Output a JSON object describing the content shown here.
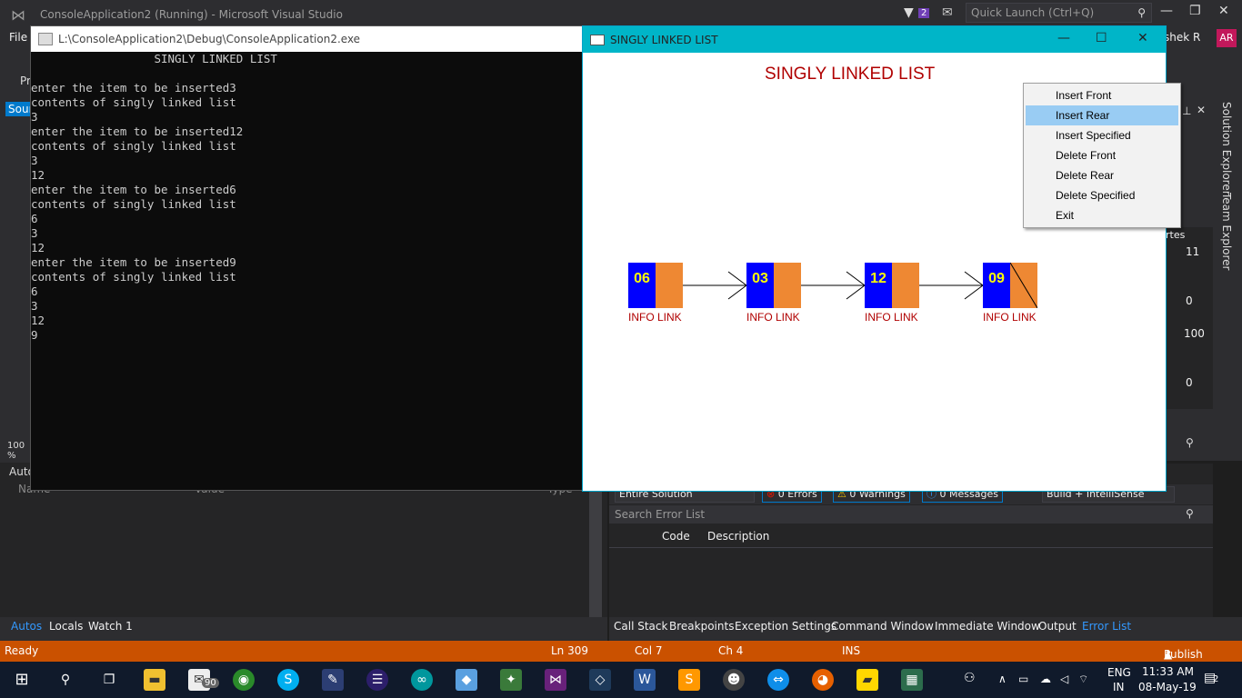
{
  "vs": {
    "title": "ConsoleApplication2 (Running) - Microsoft Visual Studio",
    "notifications": "2",
    "quick_launch": "Quick Launch (Ctrl+Q)",
    "menu_file": "File",
    "user": "shek R",
    "avatar": "AR",
    "left_tab": "Sour",
    "left_pr": "Pr",
    "zoom": "100 %"
  },
  "console": {
    "title": "L:\\ConsoleApplication2\\Debug\\ConsoleApplication2.exe",
    "lines": "                  SINGLY LINKED LIST\n\nenter the item to be inserted3\ncontents of singly linked list\n3\nenter the item to be inserted12\ncontents of singly linked list\n3\n12\nenter the item to be inserted6\ncontents of singly linked list\n6\n3\n12\nenter the item to be inserted9\ncontents of singly linked list\n6\n3\n12\n9"
  },
  "graphics": {
    "title": "SINGLY LINKED LIST",
    "heading": "SINGLY LINKED LIST",
    "nodes": [
      {
        "value": "06",
        "label": "INFO LINK"
      },
      {
        "value": "03",
        "label": "INFO LINK"
      },
      {
        "value": "12",
        "label": "INFO LINK"
      },
      {
        "value": "09",
        "label": "INFO LINK"
      }
    ],
    "colors": {
      "info": "#0000ff",
      "link": "#ee8833",
      "text": "#ffff00",
      "label": "#b00000"
    }
  },
  "context_menu": {
    "items": [
      "Insert Front",
      "Insert Rear",
      "Insert Specified",
      "Delete Front",
      "Delete Rear",
      "Delete Specified",
      "Exit"
    ],
    "selected": "Insert Rear"
  },
  "autos": {
    "header": "Autos",
    "col_name": "Name",
    "col_value": "Value",
    "col_type": "Type",
    "tabs": [
      "Autos",
      "Locals",
      "Watch 1"
    ]
  },
  "right_panel": {
    "solution_explorer": "Solution Explorer",
    "team_explorer": "Team Explorer",
    "props_label": "rtes",
    "v1": "11",
    "v2": "0",
    "v3": "100",
    "v4": "0"
  },
  "error_list": {
    "scope": "Entire Solution",
    "errors": "0 Errors",
    "warnings": "0 Warnings",
    "messages": "0 Messages",
    "filter": "Build + IntelliSense",
    "search": "Search Error List",
    "col_code": "Code",
    "col_desc": "Description",
    "tabs": [
      "Call Stack",
      "Breakpoints",
      "Exception Settings",
      "Command Window",
      "Immediate Window",
      "Output",
      "Error List"
    ]
  },
  "status": {
    "ready": "Ready",
    "ln": "Ln 309",
    "col": "Col 7",
    "ch": "Ch 4",
    "ins": "INS",
    "publish": "Publish"
  },
  "taskbar": {
    "lang1": "ENG",
    "lang2": "IN",
    "time": "11:33 AM",
    "date": "08-May-19",
    "mail_badge": "90",
    "notif_badge": "2"
  }
}
